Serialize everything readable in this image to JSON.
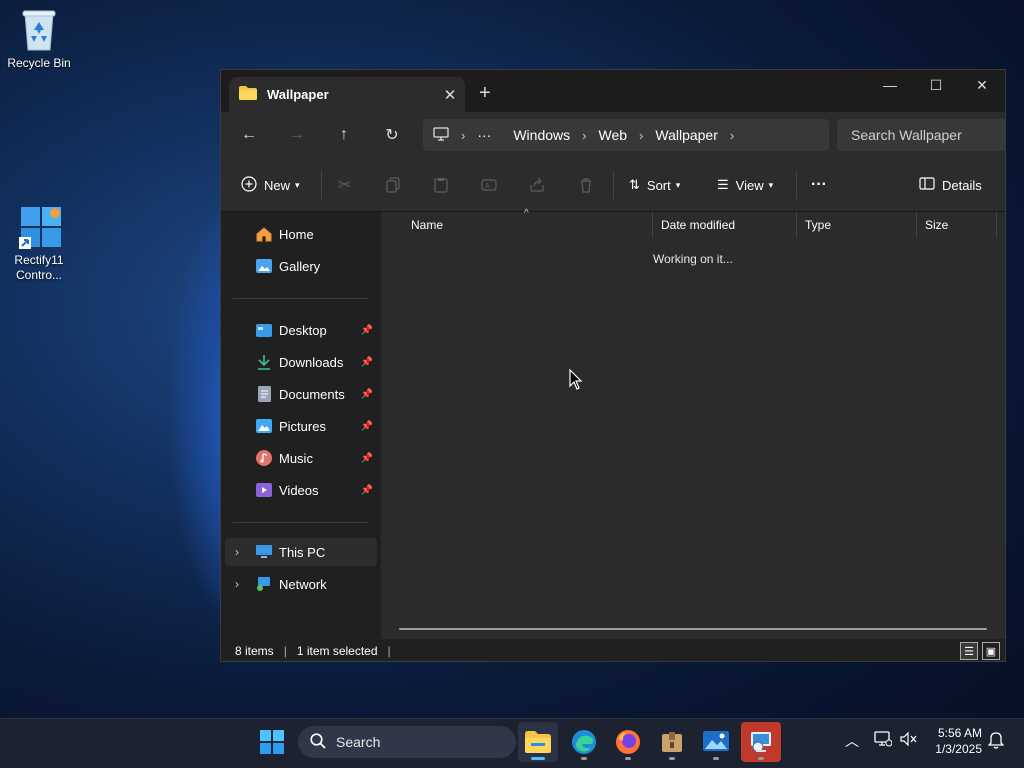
{
  "desktop": {
    "icons": [
      {
        "label": "Recycle Bin",
        "icon": "recycle-bin-icon"
      },
      {
        "label": "Rectify11 Contro...",
        "icon": "rectify11-control-panel-icon"
      }
    ]
  },
  "window": {
    "tab_title": "Wallpaper",
    "controls": {
      "minimize": "—",
      "maximize": "☐",
      "close": "✕"
    },
    "breadcrumb": {
      "more": "···",
      "segments": [
        "Windows",
        "Web",
        "Wallpaper"
      ]
    },
    "search_placeholder": "Search Wallpaper",
    "toolbar": {
      "new_label": "New",
      "sort_label": "Sort",
      "view_label": "View",
      "more_label": "···",
      "details_label": "Details"
    },
    "sidebar": {
      "top": [
        {
          "label": "Home",
          "icon": "home-icon"
        },
        {
          "label": "Gallery",
          "icon": "gallery-icon"
        }
      ],
      "pinned": [
        {
          "label": "Desktop",
          "icon": "desktop-folder-icon"
        },
        {
          "label": "Downloads",
          "icon": "downloads-icon"
        },
        {
          "label": "Documents",
          "icon": "documents-icon"
        },
        {
          "label": "Pictures",
          "icon": "pictures-icon"
        },
        {
          "label": "Music",
          "icon": "music-icon"
        },
        {
          "label": "Videos",
          "icon": "videos-icon"
        }
      ],
      "locations": [
        {
          "label": "This PC",
          "icon": "this-pc-icon"
        },
        {
          "label": "Network",
          "icon": "network-icon"
        }
      ]
    },
    "columns": [
      "Name",
      "Date modified",
      "Type",
      "Size"
    ],
    "loading_text": "Working on it...",
    "status": {
      "items": "8 items",
      "selected": "1 item selected"
    }
  },
  "taskbar": {
    "search_label": "Search",
    "apps": [
      "file-explorer-icon",
      "edge-icon",
      "firefox-icon",
      "archive-app-icon",
      "photos-app-icon",
      "remote-app-icon"
    ],
    "clock": {
      "time": "5:56 AM",
      "date": "1/3/2025"
    }
  },
  "colors": {
    "window_bg": "#202020",
    "toolbar_bg": "#2c2c2c",
    "content_bg": "#2b2b2b",
    "folder_yellow": "#f5c542",
    "accent_blue": "#4aa3f0"
  }
}
